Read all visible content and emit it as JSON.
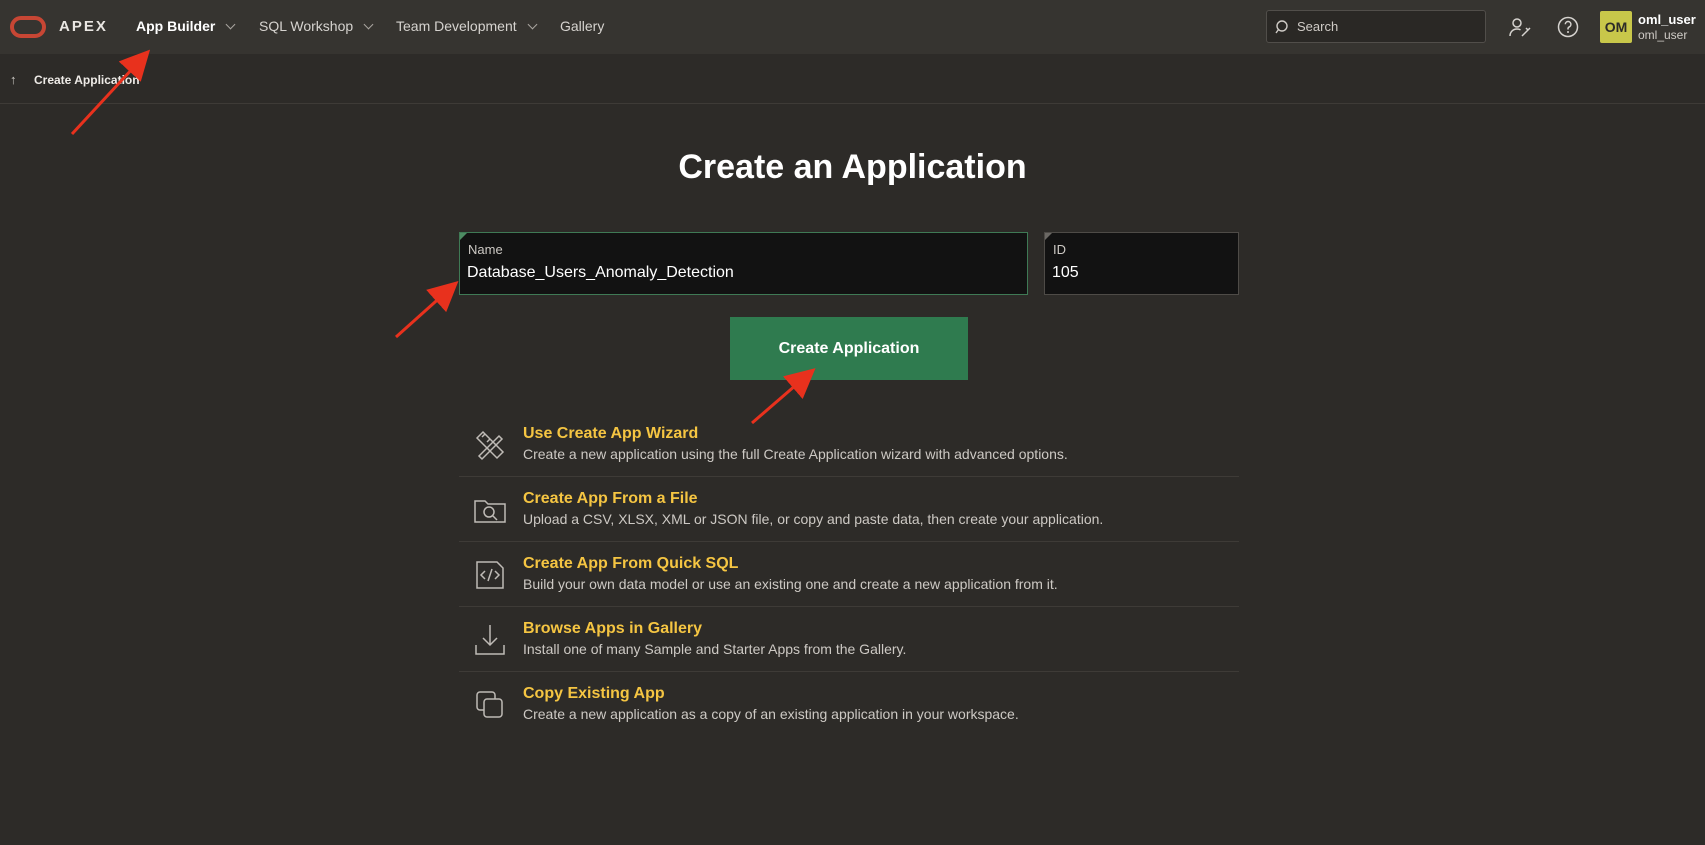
{
  "header": {
    "brand": "APEX",
    "nav": [
      {
        "label": "App Builder",
        "active": true,
        "has_menu": true
      },
      {
        "label": "SQL Workshop",
        "active": false,
        "has_menu": true
      },
      {
        "label": "Team Development",
        "active": false,
        "has_menu": true
      },
      {
        "label": "Gallery",
        "active": false,
        "has_menu": false
      }
    ],
    "search_placeholder": "Search",
    "avatar_initials": "OM",
    "user_name": "oml_user",
    "user_workspace": "oml_user"
  },
  "breadcrumb": {
    "label": "Create Application"
  },
  "main": {
    "title": "Create an Application",
    "name_label": "Name",
    "name_value": "Database_Users_Anomaly_Detection",
    "id_label": "ID",
    "id_value": "105",
    "create_button": "Create Application"
  },
  "options": [
    {
      "icon": "wizard-icon",
      "title": "Use Create App Wizard",
      "desc": "Create a new application using the full Create Application wizard with advanced options."
    },
    {
      "icon": "folder-search-icon",
      "title": "Create App From a File",
      "desc": "Upload a CSV, XLSX, XML or JSON file, or copy and paste data, then create your application."
    },
    {
      "icon": "code-icon",
      "title": "Create App From Quick SQL",
      "desc": "Build your own data model or use an existing one and create a new application from it."
    },
    {
      "icon": "download-icon",
      "title": "Browse Apps in Gallery",
      "desc": "Install one of many Sample and Starter Apps from the Gallery."
    },
    {
      "icon": "copy-icon",
      "title": "Copy Existing App",
      "desc": "Create a new application as a copy of an existing application in your workspace."
    }
  ],
  "colors": {
    "background": "#2d2b28",
    "topbar": "#363430",
    "accent_green": "#2f7b4f",
    "option_title": "#f5c542",
    "annotation_red": "#e8311d",
    "logo_red": "#c74634"
  }
}
